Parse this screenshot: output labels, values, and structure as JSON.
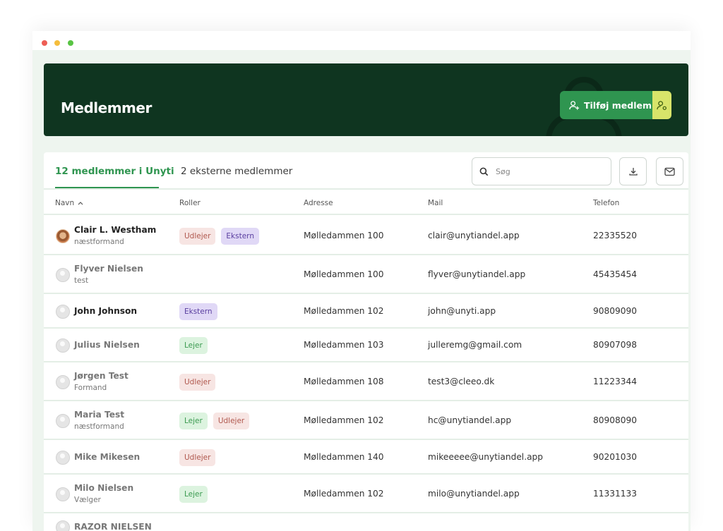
{
  "header": {
    "title": "Medlemmer",
    "add_button_label": "Tilføj medlem"
  },
  "tabs": [
    {
      "label": "12 medlemmer i Unyti",
      "active": true
    },
    {
      "label": "2 eksterne medlemmer",
      "active": false
    }
  ],
  "search": {
    "placeholder": "Søg"
  },
  "columns": {
    "name": "Navn",
    "roles": "Roller",
    "address": "Adresse",
    "mail": "Mail",
    "phone": "Telefon"
  },
  "members": [
    {
      "name": "Clair L. Westham",
      "subtitle": "næstformand",
      "roles": [
        "Udlejer",
        "Ekstern"
      ],
      "address": "Mølledammen 100",
      "mail": "clair@unytiandel.app",
      "phone": "22335520"
    },
    {
      "name": "Flyver Nielsen",
      "subtitle": "test",
      "roles": [],
      "address": "Mølledammen 100",
      "mail": "flyver@unytiandel.app",
      "phone": "45435454"
    },
    {
      "name": "John Johnson",
      "subtitle": "",
      "roles": [
        "Ekstern"
      ],
      "address": "Mølledammen 102",
      "mail": "john@unyti.app",
      "phone": "90809090"
    },
    {
      "name": "Julius Nielsen",
      "subtitle": "",
      "roles": [
        "Lejer"
      ],
      "address": "Mølledammen 103",
      "mail": "julleremg@gmail.com",
      "phone": "80907098"
    },
    {
      "name": "Jørgen Test",
      "subtitle": "Formand",
      "roles": [
        "Udlejer"
      ],
      "address": "Mølledammen 108",
      "mail": "test3@cleeo.dk",
      "phone": "11223344"
    },
    {
      "name": "Maria Test",
      "subtitle": "næstformand",
      "roles": [
        "Lejer",
        "Udlejer"
      ],
      "address": "Mølledammen 102",
      "mail": "hc@unytiandel.app",
      "phone": "80908090"
    },
    {
      "name": "Mike Mikesen",
      "subtitle": "",
      "roles": [
        "Udlejer"
      ],
      "address": "Mølledammen 140",
      "mail": "mikeeeee@unytiandel.app",
      "phone": "90201030"
    },
    {
      "name": "Milo Nielsen",
      "subtitle": "Vælger",
      "roles": [
        "Lejer"
      ],
      "address": "Mølledammen 102",
      "mail": "milo@unytiandel.app",
      "phone": "11331133"
    },
    {
      "name": "RAZOR NIELSEN",
      "subtitle": "",
      "roles": [],
      "address": "",
      "mail": "",
      "phone": ""
    }
  ],
  "colors": {
    "brand_dark": "#0f3520",
    "brand_green": "#2f9550",
    "accent_lime": "#d8e46a",
    "role_udlejer": "#b0584e",
    "role_ekstern": "#5a3fa0",
    "role_lejer": "#3b9a50"
  }
}
